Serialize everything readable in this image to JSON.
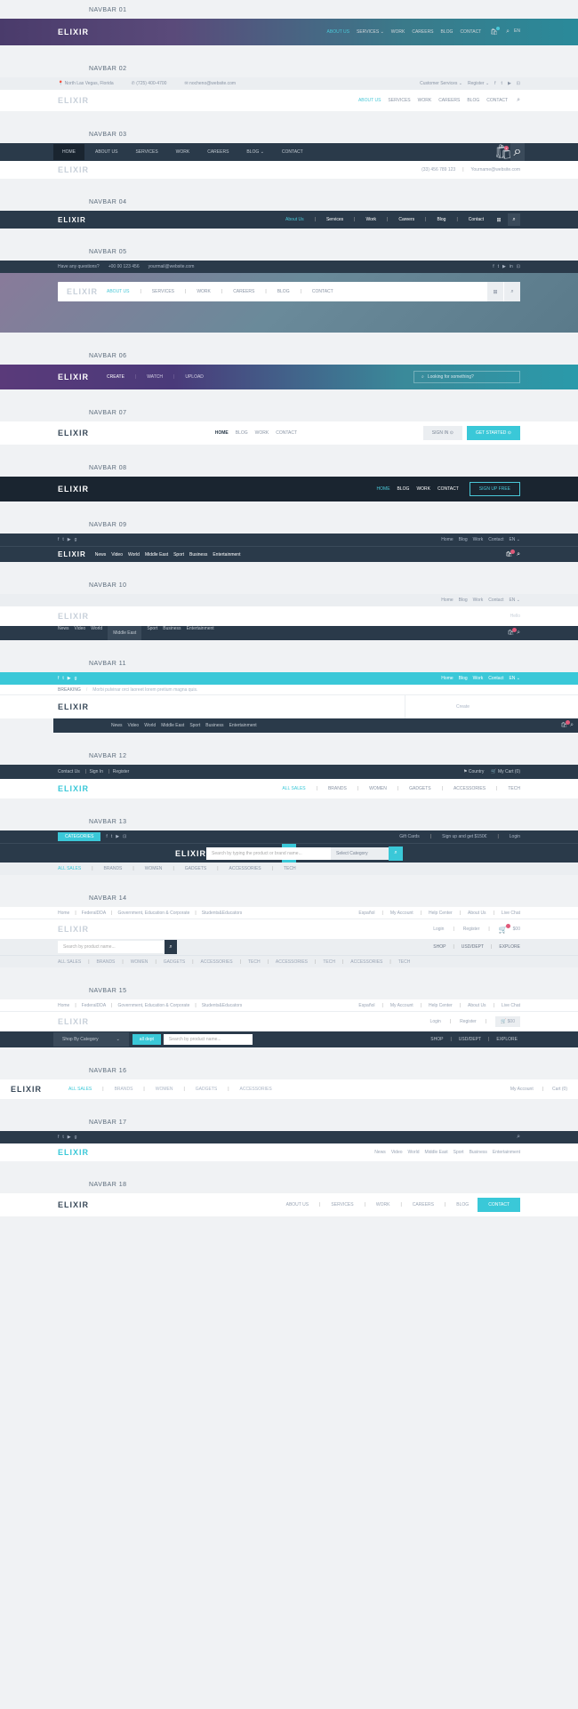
{
  "labels": {
    "n1": "NAVBAR 01",
    "n2": "NAVBAR 02",
    "n3": "NAVBAR 03",
    "n4": "NAVBAR 04",
    "n5": "NAVBAR 05",
    "n6": "NAVBAR 06",
    "n7": "NAVBAR 07",
    "n8": "NAVBAR 08",
    "n9": "NAVBAR 09",
    "n10": "NAVBAR 10",
    "n11": "NAVBAR 11",
    "n12": "NAVBAR 12",
    "n13": "NAVBAR 13",
    "n14": "NAVBAR 14",
    "n15": "NAVBAR 15",
    "n16": "NAVBAR 16",
    "n17": "NAVBAR 17",
    "n18": "NAVBAR 18"
  },
  "logo": "ELIXIR",
  "icons": {
    "search": "⌕",
    "cart": "🛒",
    "user": "👤",
    "phone": "✆",
    "mail": "✉",
    "pin": "📍",
    "f": "f",
    "t": "t",
    "yt": "▶",
    "in": "in",
    "g": "g",
    "chev": "⌄",
    "flag": "⚑",
    "grid": "⊞"
  },
  "n1": {
    "menu": [
      "ABOUT US",
      "SERVICES ⌄",
      "WORK",
      "CAREERS",
      "BLOG",
      "CONTACT"
    ],
    "lang": "EN"
  },
  "n2": {
    "loc": "North Las Vegas, Florida",
    "ph": "(725) 400-4700",
    "em": "nocheno@website.com",
    "cs": "Customer Services ⌄",
    "reg": "Register ⌄",
    "menu": [
      "ABOUT US",
      "SERVICES",
      "WORK",
      "CAREERS",
      "BLOG",
      "CONTACT"
    ]
  },
  "n3": {
    "menu": [
      "HOME",
      "ABOUT US",
      "SERVICES",
      "WORK",
      "CAREERS",
      "BLOG ⌄",
      "CONTACT"
    ],
    "ph": "(33) 456 789 123",
    "em": "Yourname@website.com",
    "badge": "2"
  },
  "n4": {
    "menu": [
      "About Us",
      "Services",
      "Work",
      "Careers",
      "Blog",
      "Contact"
    ]
  },
  "n5": {
    "q": "Have any questions?",
    "ph": "+00 00 123 456",
    "em": "yourmail@website.com",
    "menu": [
      "ABOUT US",
      "SERVICES",
      "WORK",
      "CAREERS",
      "BLOG",
      "CONTACT"
    ]
  },
  "n6": {
    "menu": [
      "CREATE",
      "WATCH",
      "UPLOAD"
    ],
    "ph": "Looking for something?"
  },
  "n7": {
    "menu": [
      "HOME",
      "BLOG",
      "WORK",
      "CONTACT"
    ],
    "b1": "SIGN IN  ⊙",
    "b2": "GET STARTED  ⊙"
  },
  "n8": {
    "menu": [
      "HOME",
      "BLOG",
      "WORK",
      "CONTACT"
    ],
    "btn": "SIGN UP FREE"
  },
  "n9": {
    "top": [
      "Home",
      "Blog",
      "Work",
      "Contact"
    ],
    "en": "EN ⌄",
    "menu": [
      "News",
      "Video",
      "World",
      "Middle East",
      "Sport",
      "Business",
      "Entertainment"
    ]
  },
  "n10": {
    "top": [
      "Home",
      "Blog",
      "Work",
      "Contact"
    ],
    "en": "EN ⌄",
    "hello": "Hello",
    "menu": [
      "News",
      "Video",
      "World",
      "Middle East",
      "Sport",
      "Business",
      "Entertainment"
    ]
  },
  "n11": {
    "top": [
      "Home",
      "Blog",
      "Work",
      "Contact"
    ],
    "en": "EN ⌄",
    "bc1": "BREAKING",
    "bc2": "Morbi pulvinar orci laoreet lorem pretium magna quis.",
    "create": "Create",
    "menu": [
      "News",
      "Video",
      "World",
      "Middle East",
      "Sport",
      "Business",
      "Entertainment"
    ]
  },
  "n12": {
    "cu": "Contact Us",
    "si": "Sign In",
    "rg": "Register",
    "cn": "⚑ Country",
    "cart": "🛒 My Cart (0)",
    "menu": [
      "ALL SALES",
      "BRANDS",
      "WOMEN",
      "GADGETS",
      "ACCESSORIES",
      "TECH"
    ]
  },
  "n13": {
    "cat": "CATEGORIES",
    "gc": "Gift Cards",
    "sp": "Sign up and get $150€",
    "lg": "Login",
    "ph": "Search by typing the product or brand name...",
    "sc": "Select Category",
    "menu": [
      "ALL SALES",
      "BRANDS",
      "WOMEN",
      "GADGETS",
      "ACCESSORIES",
      "TECH"
    ]
  },
  "n14": {
    "top": [
      "Home",
      "FederalDDA",
      "Government, Education & Corporate",
      "Students&Educators"
    ],
    "rt": [
      "Español",
      "My Account",
      "Help Center",
      "About Us",
      "Live Chat"
    ],
    "lg": "Login",
    "rg": "Register",
    "cart": "$00",
    "sp": "Search by product name...",
    "rm": [
      "SHOP",
      "USD/DEPT",
      "EXPLORE"
    ],
    "menu": [
      "ALL SALES",
      "BRANDS",
      "WOMEN",
      "GADGETS",
      "ACCESSORIES",
      "TECH",
      "ACCESSORIES",
      "TECH",
      "ACCESSORIES",
      "TECH"
    ]
  },
  "n15": {
    "top": [
      "Home",
      "FederalDDA",
      "Government, Education & Corporate",
      "Students&Educators"
    ],
    "rt": [
      "Español",
      "My Account",
      "Help Center",
      "About Us",
      "Live Chat"
    ],
    "lg": "Login",
    "rg": "Register",
    "cart": "🛒 $00",
    "sbc": "Shop By Category",
    "all": "all dept",
    "sp": "Search by product name...",
    "rm": [
      "SHOP",
      "USD/DEPT",
      "EXPLORE"
    ]
  },
  "n16": {
    "menu": [
      "ALL SALES",
      "BRANDS",
      "WOMEN",
      "GADGETS",
      "ACCESSORIES"
    ],
    "acc": "My Account",
    "cart": "Cart (0)"
  },
  "n17": {
    "menu": [
      "News",
      "Video",
      "World",
      "Middle East",
      "Sport",
      "Business",
      "Entertainment"
    ]
  },
  "n18": {
    "menu": [
      "ABOUT US",
      "SERVICES",
      "WORK",
      "CAREERS",
      "BLOG"
    ],
    "btn": "CONTACT"
  }
}
